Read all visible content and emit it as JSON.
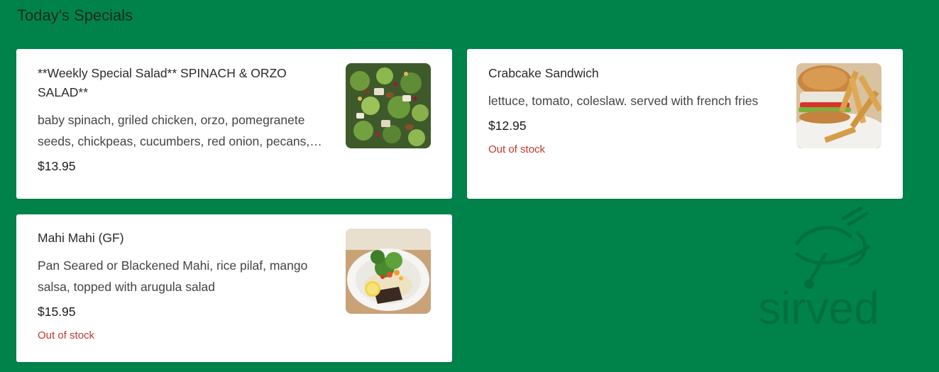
{
  "section": {
    "title": "Today's Specials"
  },
  "items": [
    {
      "name": "**Weekly Special Salad** SPINACH & ORZO SALAD**",
      "description": "baby spinach, griled chicken, orzo, pomegranete seeds, chickpeas, cucumbers, red onion, pecans,…",
      "price": "$13.95",
      "stock": "",
      "image_icon": "salad-photo"
    },
    {
      "name": "Crabcake Sandwich",
      "description": "lettuce, tomato, coleslaw. served with french fries",
      "price": "$12.95",
      "stock": "Out of stock",
      "image_icon": "sandwich-photo"
    },
    {
      "name": "Mahi Mahi (GF)",
      "description": "Pan Seared or Blackened Mahi, rice pilaf, mango salsa, topped with arugula salad",
      "price": "$15.95",
      "stock": "Out of stock",
      "image_icon": "fish-plate-photo"
    }
  ],
  "watermark": {
    "text": "sirved"
  },
  "colors": {
    "background": "#00834a",
    "card": "#ffffff",
    "out_of_stock": "#c0392b"
  }
}
